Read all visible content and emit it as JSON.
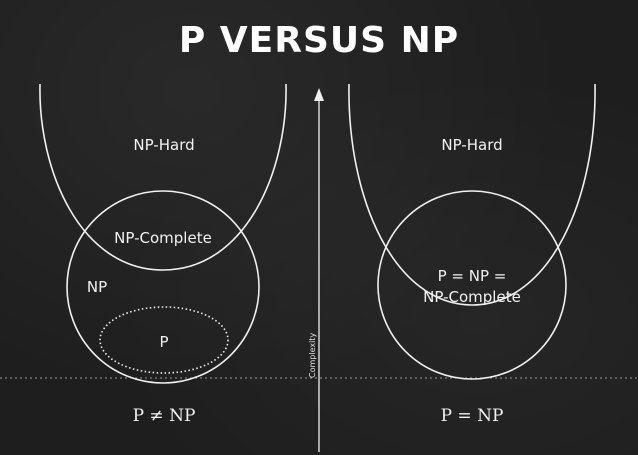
{
  "title": "P VERSUS NP",
  "axis_label": "Complexity",
  "left": {
    "np_hard": "NP-Hard",
    "np_complete": "NP-Complete",
    "np": "NP",
    "p": "P",
    "caption": "P ≠ NP"
  },
  "right": {
    "np_hard": "NP-Hard",
    "merged_line1": "P = NP =",
    "merged_line2": "NP-Complete",
    "caption": "P = NP"
  },
  "colors": {
    "background": "#1e1e1e",
    "chalk": "#f0f0f0"
  }
}
